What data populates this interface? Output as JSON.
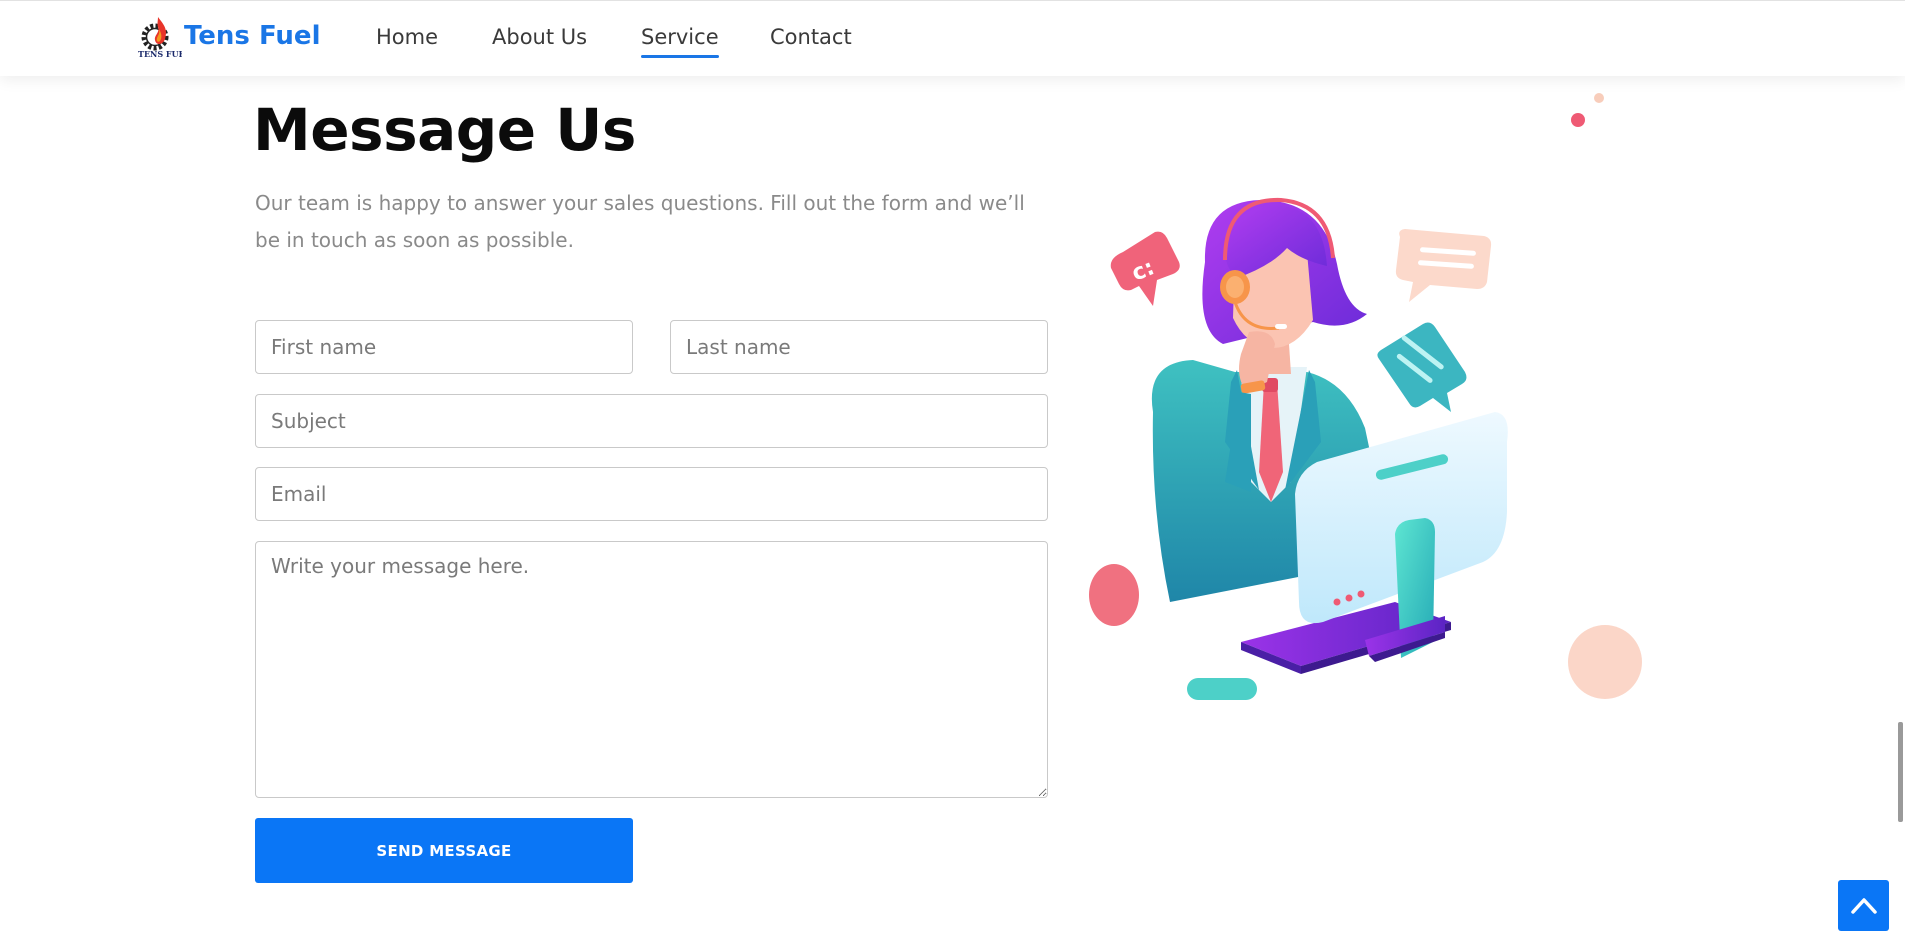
{
  "header": {
    "logo_text": "Tens Fuel",
    "logo_small_text": "TENS FUEL",
    "nav": [
      {
        "label": "Home",
        "active": false
      },
      {
        "label": "About Us",
        "active": false
      },
      {
        "label": "Service",
        "active": true
      },
      {
        "label": "Contact",
        "active": false
      }
    ]
  },
  "main": {
    "title": "Message Us",
    "subtitle": "Our team is happy to answer your sales questions. Fill out the form and we’ll be in touch as soon as possible."
  },
  "form": {
    "first_name": {
      "value": "",
      "placeholder": "First name"
    },
    "last_name": {
      "value": "",
      "placeholder": "Last name"
    },
    "subject": {
      "value": "",
      "placeholder": "Subject"
    },
    "email": {
      "value": "",
      "placeholder": "Email"
    },
    "message": {
      "value": "",
      "placeholder": "Write your message here."
    },
    "send_label": "SEND MESSAGE"
  },
  "icons": {
    "scroll_top": "chevron-up-icon",
    "illustration": "customer-support-illustration"
  },
  "colors": {
    "accent": "#0a76f6",
    "brand": "#1a76e6",
    "title": "#0b0b0b",
    "muted_text": "#8a8a8a"
  }
}
